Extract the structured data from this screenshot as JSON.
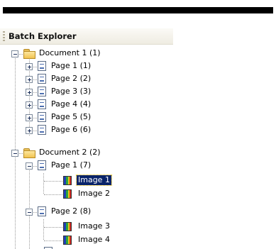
{
  "panel": {
    "title": "Batch Explorer"
  },
  "tree": {
    "documents": [
      {
        "label": "Document 1 (1)",
        "pages": [
          {
            "label": "Page 1 (1)"
          },
          {
            "label": "Page 2 (2)"
          },
          {
            "label": "Page 3 (3)"
          },
          {
            "label": "Page 4 (4)"
          },
          {
            "label": "Page 5 (5)"
          },
          {
            "label": "Page 6 (6)"
          }
        ]
      },
      {
        "label": "Document 2 (2)",
        "pages": [
          {
            "label": "Page 1 (7)",
            "images": [
              {
                "label": "Image 1",
                "selected": true
              },
              {
                "label": "Image 2"
              }
            ]
          },
          {
            "label": "Page 2 (8)",
            "images": [
              {
                "label": "Image 3"
              },
              {
                "label": "Image 4"
              }
            ]
          }
        ]
      }
    ]
  },
  "colors": {
    "selection_bg": "#0a246a",
    "selection_text": "#ffffff",
    "folder": "#f2c451"
  },
  "icons": {
    "collapse": "minus-box-icon",
    "expand": "plus-box-icon",
    "document": "folder-open-icon",
    "page": "page-icon",
    "image": "image-icon"
  }
}
